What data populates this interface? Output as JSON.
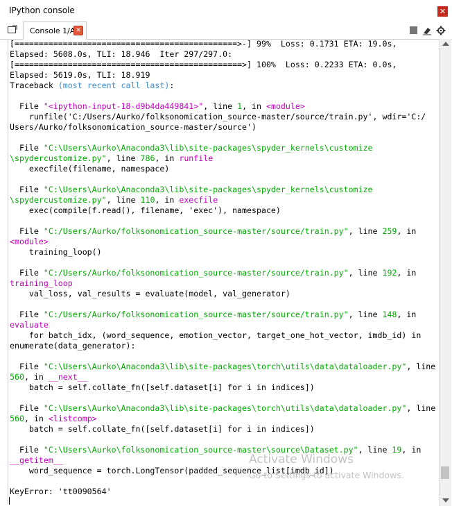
{
  "window": {
    "title": "IPython console",
    "close_label": "✕"
  },
  "tab": {
    "label": "Console 1/A",
    "close_label": "✕"
  },
  "toolbar": {
    "stop_icon": "stop-icon",
    "eraser_icon": "eraser-icon",
    "options_icon": "gear-icon"
  },
  "console": {
    "lines": [
      [
        {
          "t": "[==============================================>-] 99%  Loss: 0.1731 ETA: 19.0s,"
        }
      ],
      [
        {
          "t": "Elapsed: 5608.0s, TLI: 18.946  Iter 297/297.0:"
        }
      ],
      [
        {
          "t": "[===============================================>] 100%  Loss: 0.2233 ETA: 0.0s,"
        }
      ],
      [
        {
          "t": "Elapsed: 5619.0s, TLI: 18.919"
        }
      ],
      [
        {
          "t": "Traceback "
        },
        {
          "t": "(most recent call last)",
          "c": "blue"
        },
        {
          "t": ":"
        }
      ],
      [
        {
          "t": ""
        }
      ],
      [
        {
          "t": "  File "
        },
        {
          "t": "\"<ipython-input-18-d9b4da449841>\"",
          "c": "mag"
        },
        {
          "t": ", line "
        },
        {
          "t": "1",
          "c": "green"
        },
        {
          "t": ", in "
        },
        {
          "t": "<module>",
          "c": "mag"
        }
      ],
      [
        {
          "t": "    runfile('C:/Users/Aurko/folksonomication_source-master/source/train.py', wdir='C:/"
        }
      ],
      [
        {
          "t": "Users/Aurko/folksonomication_source-master/source')"
        }
      ],
      [
        {
          "t": ""
        }
      ],
      [
        {
          "t": "  File "
        },
        {
          "t": "\"C:\\Users\\Aurko\\Anaconda3\\lib\\site-packages\\spyder_kernels\\customize",
          "c": "green"
        }
      ],
      [
        {
          "t": "\\spydercustomize.py\"",
          "c": "green"
        },
        {
          "t": ", line "
        },
        {
          "t": "786",
          "c": "green"
        },
        {
          "t": ", in "
        },
        {
          "t": "runfile",
          "c": "mag"
        }
      ],
      [
        {
          "t": "    execfile(filename, namespace)"
        }
      ],
      [
        {
          "t": ""
        }
      ],
      [
        {
          "t": "  File "
        },
        {
          "t": "\"C:\\Users\\Aurko\\Anaconda3\\lib\\site-packages\\spyder_kernels\\customize",
          "c": "green"
        }
      ],
      [
        {
          "t": "\\spydercustomize.py\"",
          "c": "green"
        },
        {
          "t": ", line "
        },
        {
          "t": "110",
          "c": "green"
        },
        {
          "t": ", in "
        },
        {
          "t": "execfile",
          "c": "mag"
        }
      ],
      [
        {
          "t": "    exec(compile(f.read(), filename, 'exec'), namespace)"
        }
      ],
      [
        {
          "t": ""
        }
      ],
      [
        {
          "t": "  File "
        },
        {
          "t": "\"C:/Users/Aurko/folksonomication_source-master/source/train.py\"",
          "c": "green"
        },
        {
          "t": ", line "
        },
        {
          "t": "259",
          "c": "green"
        },
        {
          "t": ", in"
        }
      ],
      [
        {
          "t": "<module>",
          "c": "mag"
        }
      ],
      [
        {
          "t": "    training_loop()"
        }
      ],
      [
        {
          "t": ""
        }
      ],
      [
        {
          "t": "  File "
        },
        {
          "t": "\"C:/Users/Aurko/folksonomication_source-master/source/train.py\"",
          "c": "green"
        },
        {
          "t": ", line "
        },
        {
          "t": "192",
          "c": "green"
        },
        {
          "t": ", in"
        }
      ],
      [
        {
          "t": "training_loop",
          "c": "mag"
        }
      ],
      [
        {
          "t": "    val_loss, val_results = evaluate(model, val_generator)"
        }
      ],
      [
        {
          "t": ""
        }
      ],
      [
        {
          "t": "  File "
        },
        {
          "t": "\"C:/Users/Aurko/folksonomication_source-master/source/train.py\"",
          "c": "green"
        },
        {
          "t": ", line "
        },
        {
          "t": "148",
          "c": "green"
        },
        {
          "t": ", in"
        }
      ],
      [
        {
          "t": "evaluate",
          "c": "mag"
        }
      ],
      [
        {
          "t": "    for batch_idx, (word_sequence, emotion_vector, target_one_hot_vector, imdb_id) in"
        }
      ],
      [
        {
          "t": "enumerate(data_generator):"
        }
      ],
      [
        {
          "t": ""
        }
      ],
      [
        {
          "t": "  File "
        },
        {
          "t": "\"C:\\Users\\Aurko\\Anaconda3\\lib\\site-packages\\torch\\utils\\data\\dataloader.py\"",
          "c": "green"
        },
        {
          "t": ", line"
        }
      ],
      [
        {
          "t": "560",
          "c": "green"
        },
        {
          "t": ", in "
        },
        {
          "t": "__next__",
          "c": "mag"
        }
      ],
      [
        {
          "t": "    batch = self.collate_fn([self.dataset[i] for i in indices])"
        }
      ],
      [
        {
          "t": ""
        }
      ],
      [
        {
          "t": "  File "
        },
        {
          "t": "\"C:\\Users\\Aurko\\Anaconda3\\lib\\site-packages\\torch\\utils\\data\\dataloader.py\"",
          "c": "green"
        },
        {
          "t": ", line"
        }
      ],
      [
        {
          "t": "560",
          "c": "green"
        },
        {
          "t": ", in "
        },
        {
          "t": "<listcomp>",
          "c": "mag"
        }
      ],
      [
        {
          "t": "    batch = self.collate_fn([self.dataset[i] for i in indices])"
        }
      ],
      [
        {
          "t": ""
        }
      ],
      [
        {
          "t": "  File "
        },
        {
          "t": "\"C:\\Users\\Aurko\\folksonomication_source-master\\source\\Dataset.py\"",
          "c": "green"
        },
        {
          "t": ", line "
        },
        {
          "t": "19",
          "c": "green"
        },
        {
          "t": ", in"
        }
      ],
      [
        {
          "t": "__getitem__",
          "c": "mag"
        }
      ],
      [
        {
          "t": "    word_sequence = torch.LongTensor(padded_sequence_list[imdb_id])"
        }
      ],
      [
        {
          "t": ""
        }
      ],
      [
        {
          "t": "KeyError: 'tt0090564'"
        }
      ]
    ]
  },
  "watermark": {
    "line1": "Activate Windows",
    "line2": "Go to Settings to activate Windows."
  }
}
